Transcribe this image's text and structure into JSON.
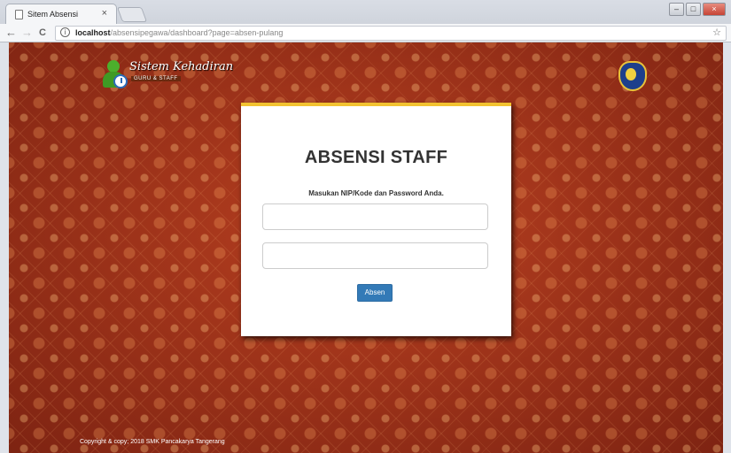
{
  "browser": {
    "tab_title": "Sitem Absensi",
    "tab_close": "×",
    "url_host": "localhost",
    "url_path": "/absensipegawa/dashboard?page=absen-pulang",
    "back": "←",
    "forward": "→",
    "reload": "C",
    "info": "i",
    "star": "☆",
    "win_min": "–",
    "win_max": "□",
    "win_close": "×"
  },
  "header": {
    "brand": "Sistem Kehadiran",
    "brand_sub": "GURU & STAFF"
  },
  "login": {
    "title": "ABSENSI STAFF",
    "hint": "Masukan NIP/Kode dan Password Anda.",
    "nip_value": "",
    "password_value": "",
    "submit_label": "Absen"
  },
  "footer": {
    "copyright": "Copyright & copy; 2018 SMK Pancakarya Tangerang"
  },
  "colors": {
    "accent_bar": "#f2c230",
    "button": "#337ab7",
    "background": "#a9361c"
  }
}
